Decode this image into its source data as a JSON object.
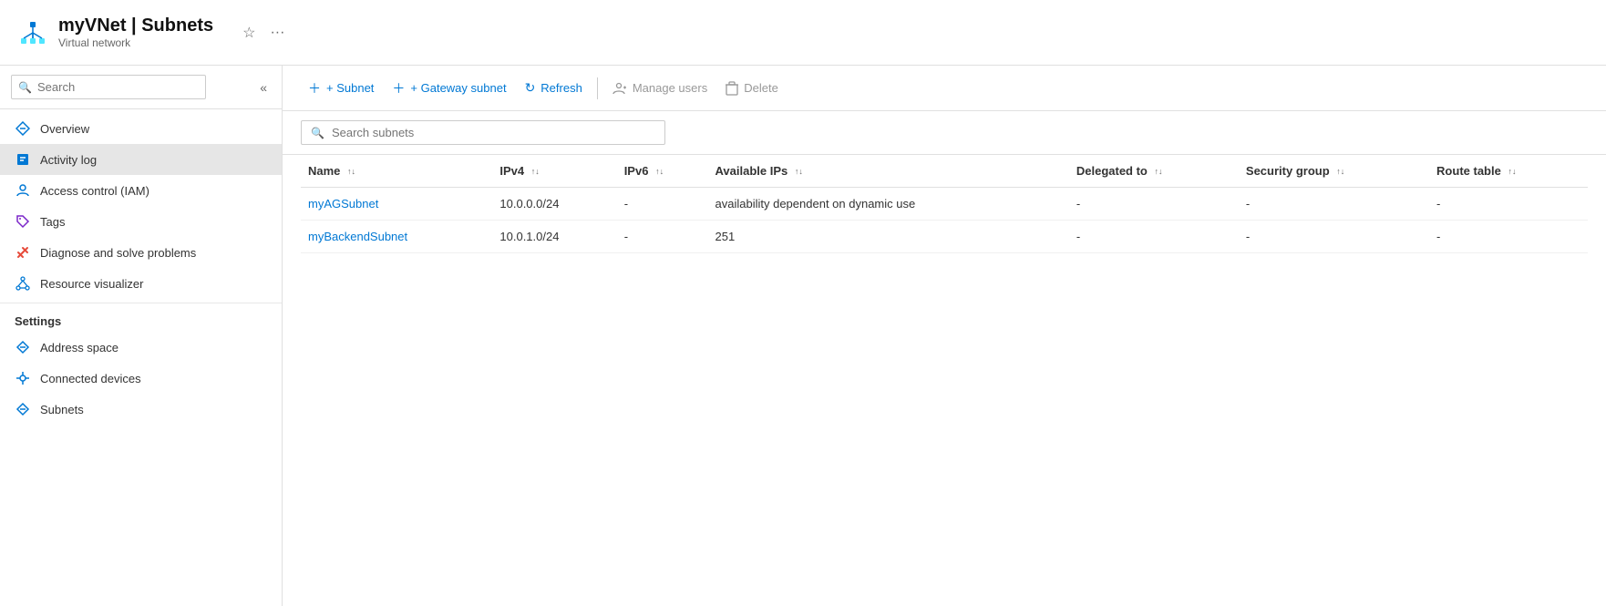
{
  "header": {
    "resource_name": "myVNet",
    "page_title": "Subnets",
    "resource_type": "Virtual network",
    "star_label": "★",
    "dots_label": "···"
  },
  "sidebar": {
    "search_placeholder": "Search",
    "collapse_icon": "«",
    "nav_items": [
      {
        "id": "overview",
        "label": "Overview",
        "icon": "vnet"
      },
      {
        "id": "activity-log",
        "label": "Activity log",
        "icon": "activity",
        "active": true
      },
      {
        "id": "access-control",
        "label": "Access control (IAM)",
        "icon": "iam"
      },
      {
        "id": "tags",
        "label": "Tags",
        "icon": "tag"
      },
      {
        "id": "diagnose",
        "label": "Diagnose and solve problems",
        "icon": "wrench"
      },
      {
        "id": "resource-visualizer",
        "label": "Resource visualizer",
        "icon": "visualizer"
      }
    ],
    "settings_heading": "Settings",
    "settings_items": [
      {
        "id": "address-space",
        "label": "Address space",
        "icon": "vnet"
      },
      {
        "id": "connected-devices",
        "label": "Connected devices",
        "icon": "devices"
      },
      {
        "id": "subnets",
        "label": "Subnets",
        "icon": "vnet"
      }
    ]
  },
  "toolbar": {
    "add_subnet_label": "+ Subnet",
    "add_gateway_label": "+ Gateway subnet",
    "refresh_label": "Refresh",
    "manage_users_label": "Manage users",
    "delete_label": "Delete"
  },
  "search": {
    "placeholder": "Search subnets"
  },
  "table": {
    "columns": [
      {
        "id": "name",
        "label": "Name"
      },
      {
        "id": "ipv4",
        "label": "IPv4"
      },
      {
        "id": "ipv6",
        "label": "IPv6"
      },
      {
        "id": "available-ips",
        "label": "Available IPs"
      },
      {
        "id": "delegated-to",
        "label": "Delegated to"
      },
      {
        "id": "security-group",
        "label": "Security group"
      },
      {
        "id": "route-table",
        "label": "Route table"
      }
    ],
    "rows": [
      {
        "name": "myAGSubnet",
        "ipv4": "10.0.0.0/24",
        "ipv6": "-",
        "available_ips": "availability dependent on dynamic use",
        "delegated_to": "-",
        "security_group": "-",
        "route_table": "-"
      },
      {
        "name": "myBackendSubnet",
        "ipv4": "10.0.1.0/24",
        "ipv6": "-",
        "available_ips": "251",
        "delegated_to": "-",
        "security_group": "-",
        "route_table": "-"
      }
    ]
  }
}
